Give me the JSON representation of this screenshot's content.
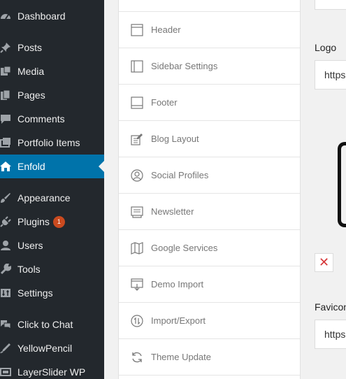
{
  "sidebar": {
    "items": [
      {
        "label": "Dashboard",
        "icon": "dashboard-icon"
      },
      {
        "label": "Posts",
        "icon": "pin-icon"
      },
      {
        "label": "Media",
        "icon": "media-icon"
      },
      {
        "label": "Pages",
        "icon": "pages-icon"
      },
      {
        "label": "Comments",
        "icon": "comment-icon"
      },
      {
        "label": "Portfolio Items",
        "icon": "portfolio-icon"
      },
      {
        "label": "Enfold",
        "icon": "home-icon",
        "active": true
      },
      {
        "label": "Appearance",
        "icon": "brush-icon"
      },
      {
        "label": "Plugins",
        "icon": "plugin-icon",
        "badge": "1"
      },
      {
        "label": "Users",
        "icon": "user-icon"
      },
      {
        "label": "Tools",
        "icon": "wrench-icon"
      },
      {
        "label": "Settings",
        "icon": "settings-icon"
      },
      {
        "label": "Click to Chat",
        "icon": "chat-icon"
      },
      {
        "label": "YellowPencil",
        "icon": "pencil-icon"
      },
      {
        "label": "LayerSlider WP",
        "icon": "slider-icon"
      }
    ]
  },
  "tabs": [
    {
      "label": "Header",
      "icon": "header-icon"
    },
    {
      "label": "Sidebar Settings",
      "icon": "sidebar-layout-icon"
    },
    {
      "label": "Footer",
      "icon": "footer-icon"
    },
    {
      "label": "Blog Layout",
      "icon": "blog-edit-icon"
    },
    {
      "label": "Social Profiles",
      "icon": "profile-icon"
    },
    {
      "label": "Newsletter",
      "icon": "newsletter-icon"
    },
    {
      "label": "Google Services",
      "icon": "map-icon"
    },
    {
      "label": "Demo Import",
      "icon": "import-screen-icon"
    },
    {
      "label": "Import/Export",
      "icon": "import-export-icon"
    },
    {
      "label": "Theme Update",
      "icon": "refresh-icon"
    }
  ],
  "panel": {
    "logo_label": "Logo",
    "logo_value": "https",
    "remove_label": "✕",
    "favicon_label": "Favicon",
    "favicon_value": "https"
  },
  "colors": {
    "sidebar_bg": "#23282d",
    "active_bg": "#0073aa",
    "badge": "#ca4a1f",
    "remove": "#d63638"
  }
}
